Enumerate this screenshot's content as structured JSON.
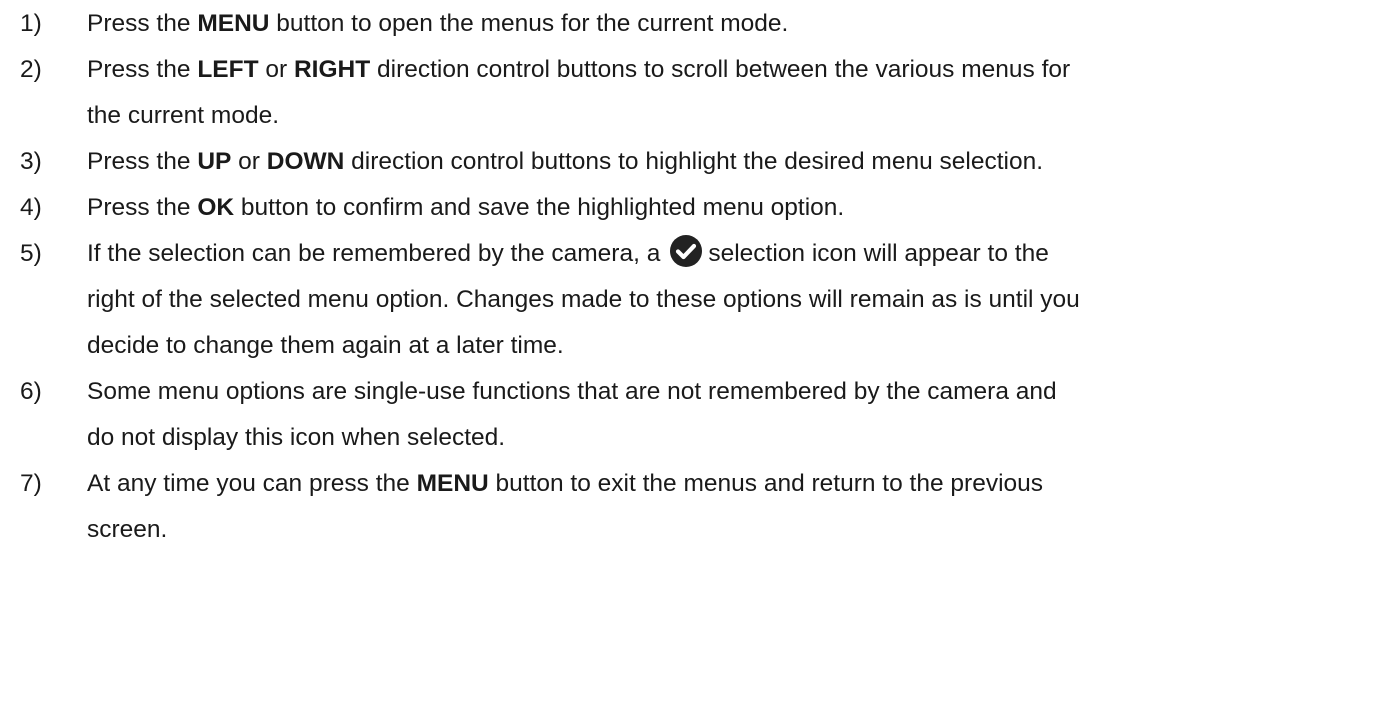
{
  "steps": [
    {
      "num": "1)",
      "lines": [
        [
          {
            "t": "Press the "
          },
          {
            "t": "MENU",
            "b": true
          },
          {
            "t": " button to open the menus for the current mode."
          }
        ]
      ]
    },
    {
      "num": "2)",
      "lines": [
        [
          {
            "t": "Press the "
          },
          {
            "t": "LEFT",
            "b": true
          },
          {
            "t": " or "
          },
          {
            "t": "RIGHT",
            "b": true
          },
          {
            "t": " direction control buttons to scroll between the various menus for"
          }
        ],
        [
          {
            "t": "the current mode."
          }
        ]
      ]
    },
    {
      "num": "3)",
      "lines": [
        [
          {
            "t": "Press the "
          },
          {
            "t": "UP",
            "b": true
          },
          {
            "t": " or "
          },
          {
            "t": "DOWN",
            "b": true
          },
          {
            "t": " direction control buttons to highlight the desired menu selection."
          }
        ]
      ]
    },
    {
      "num": "4)",
      "lines": [
        [
          {
            "t": "Press the "
          },
          {
            "t": "OK",
            "b": true
          },
          {
            "t": " button to confirm and save the highlighted menu option."
          }
        ]
      ]
    },
    {
      "num": "5)",
      "lines": [
        [
          {
            "t": "If the selection can be remembered by the camera, a"
          },
          {
            "icon": "check-circle-icon"
          },
          {
            "t": "selection icon will appear to the"
          }
        ],
        [
          {
            "t": "right of the selected menu option. Changes made to these options will remain as is until you"
          }
        ],
        [
          {
            "t": "decide to change them again at a later time."
          }
        ]
      ]
    },
    {
      "num": "6)",
      "lines": [
        [
          {
            "t": "Some menu options are single-use functions that are not remembered by the camera and"
          }
        ],
        [
          {
            "t": "do not display this icon when selected."
          }
        ]
      ]
    },
    {
      "num": "7)",
      "lines": [
        [
          {
            "t": "At any time you can press the "
          },
          {
            "t": "MENU",
            "b": true
          },
          {
            "t": " button to exit the menus and return to the previous"
          }
        ],
        [
          {
            "t": "screen."
          }
        ]
      ]
    }
  ],
  "colors": {
    "text": "#1a1a1a",
    "icon": "#222222",
    "background": "#ffffff"
  }
}
